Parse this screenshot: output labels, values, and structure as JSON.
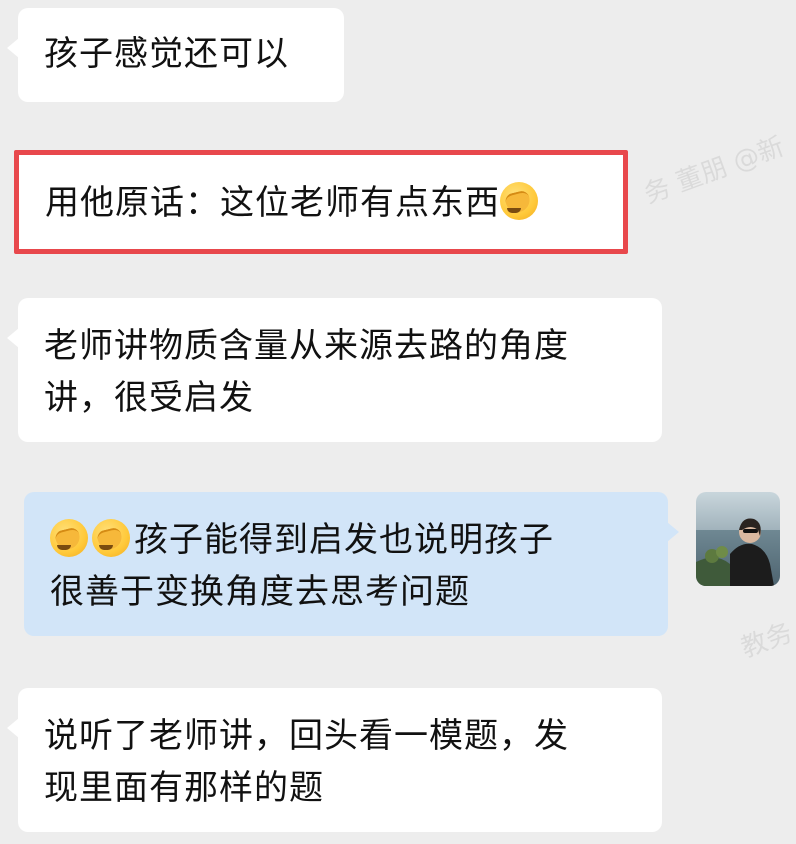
{
  "messages": [
    {
      "id": "m1",
      "side": "left",
      "text": "孩子感觉还可以"
    },
    {
      "id": "m2",
      "side": "left",
      "highlighted": true,
      "text": "用他原话：这位老师有点东西",
      "emoji": "facepalm"
    },
    {
      "id": "m3",
      "side": "left",
      "line1": "老师讲物质含量从来源去路的角度",
      "line2": "讲，很受启发"
    },
    {
      "id": "m4",
      "side": "right",
      "emoji_count": 2,
      "emoji": "facepalm",
      "line1": "孩子能得到启发也说明孩子",
      "line2": "很善于变换角度去思考问题"
    },
    {
      "id": "m5",
      "side": "left",
      "line1": "说听了老师讲，回头看一模题，发",
      "line2": "现里面有那样的题"
    }
  ],
  "colors": {
    "page_background": "#ededed",
    "incoming_bubble": "#ffffff",
    "outgoing_bubble": "#d2e5f8",
    "highlight_border": "#e8484c"
  },
  "icons": {
    "emoji": "facepalm-emoji",
    "avatar": "user-avatar"
  }
}
